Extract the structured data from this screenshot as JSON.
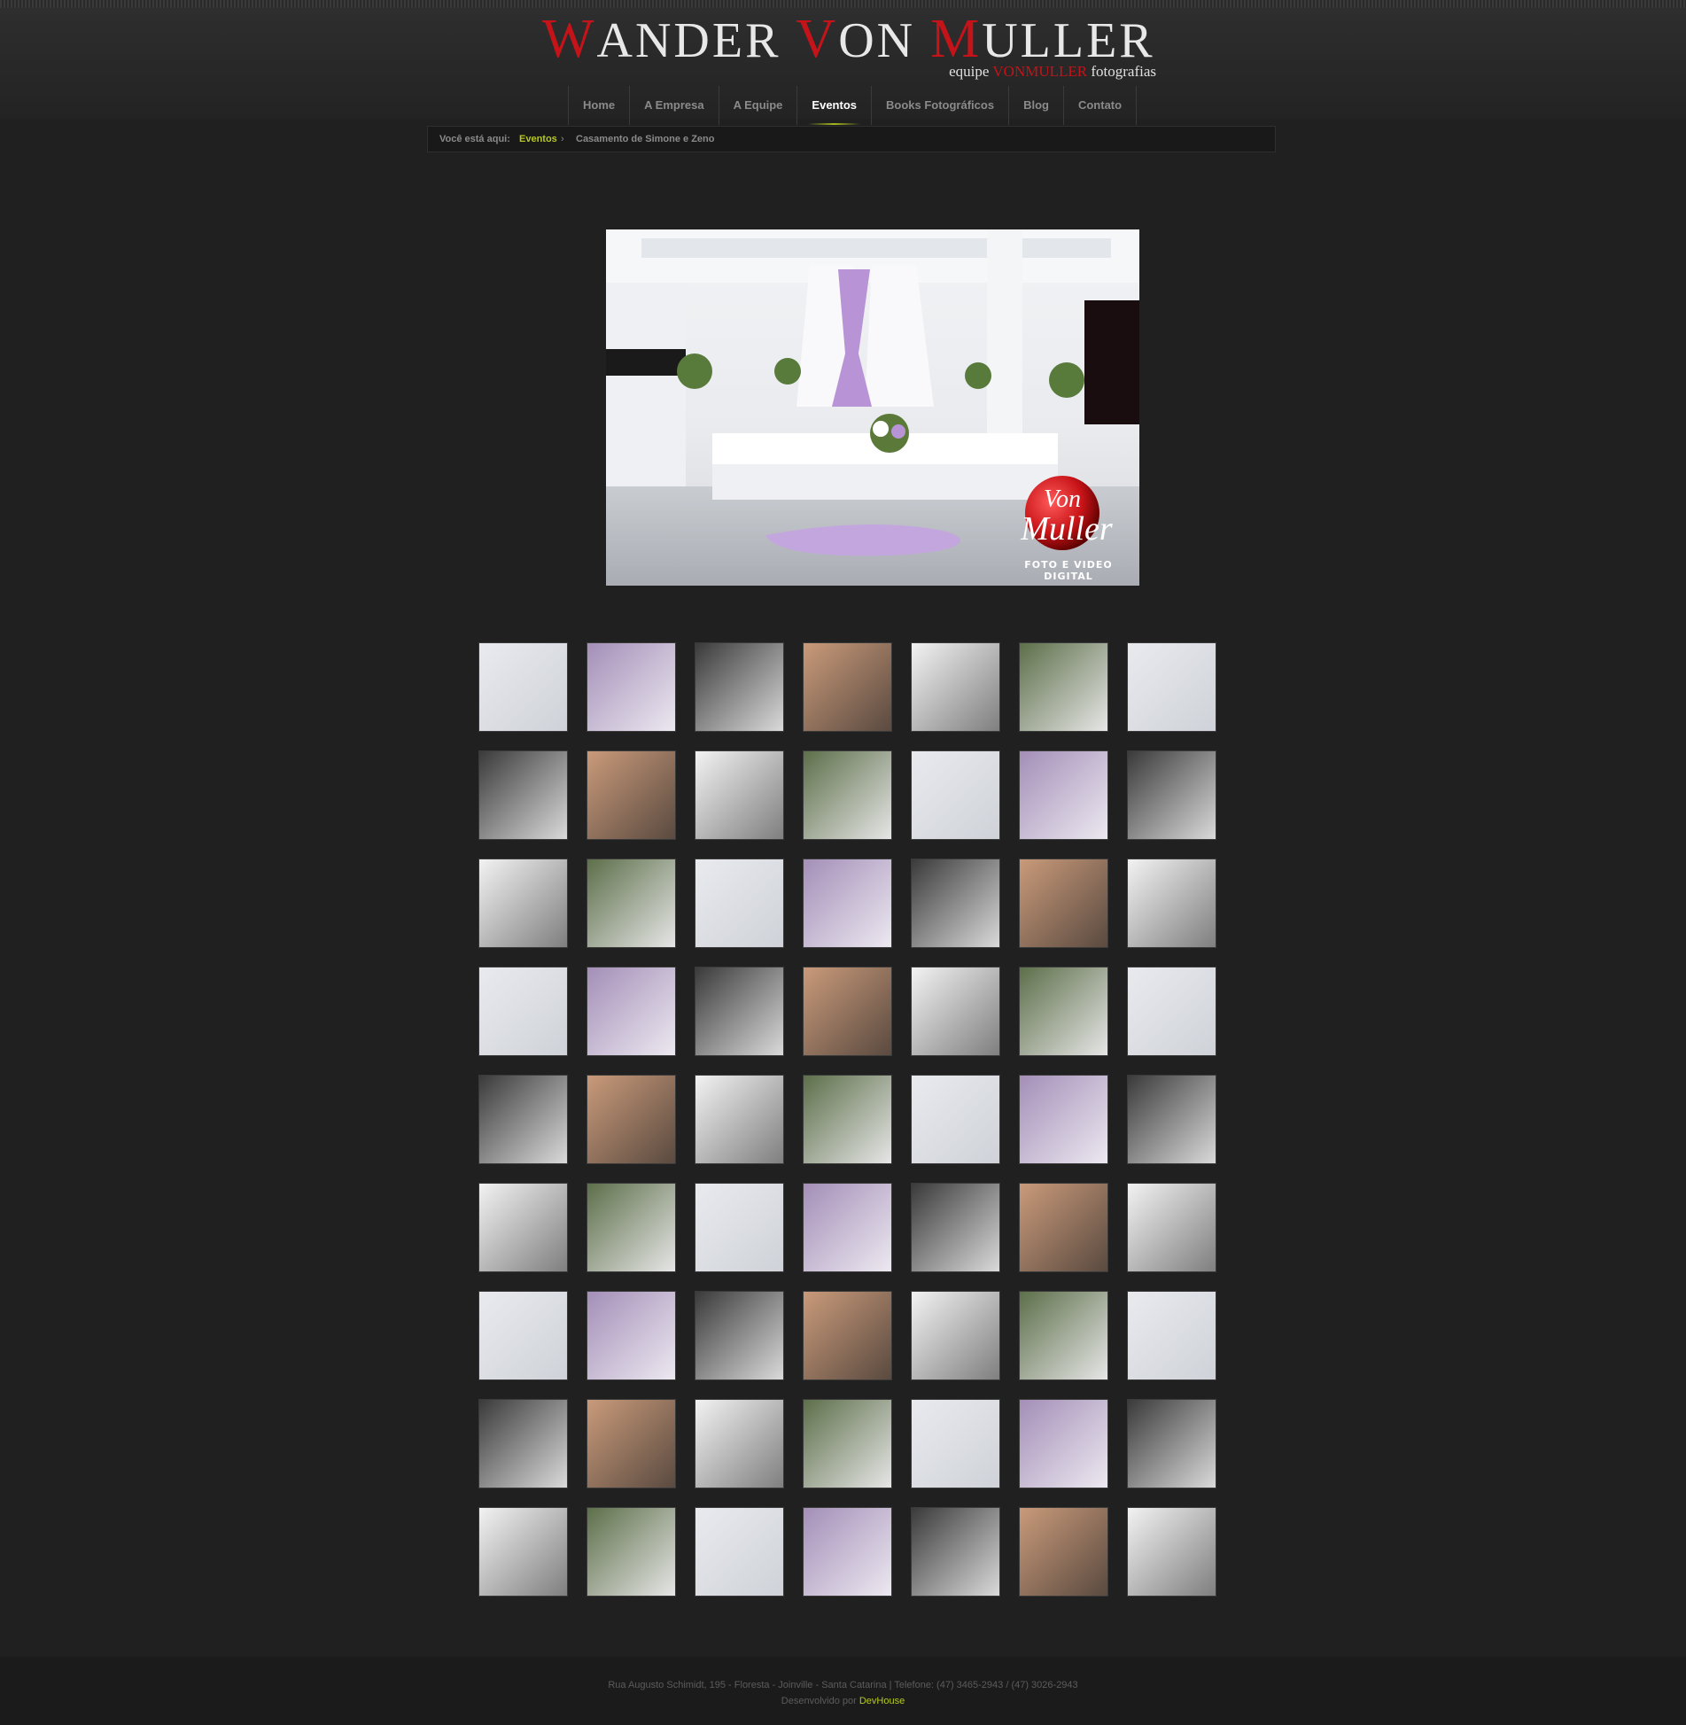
{
  "header": {
    "logo": {
      "w": "W",
      "ander": "ANDER ",
      "v": "V",
      "on": "ON ",
      "m": "M",
      "uller": "ULLER"
    },
    "tagline": {
      "prefix": "equipe ",
      "brand": "VONMULLER",
      "suffix": " fotografias"
    }
  },
  "nav": {
    "items": [
      {
        "label": "Home"
      },
      {
        "label": "A Empresa"
      },
      {
        "label": "A Equipe"
      },
      {
        "label": "Eventos"
      },
      {
        "label": "Books Fotográficos"
      },
      {
        "label": "Blog"
      },
      {
        "label": "Contato"
      }
    ],
    "active": "Eventos"
  },
  "breadcrumb": {
    "label": "Você está aqui:",
    "link": "Eventos",
    "separator": "›",
    "current": "Casamento de Simone e Zeno"
  },
  "main_photo": {
    "watermark_line1": "Von",
    "watermark_line2": "Muller",
    "watermark_caption": "FOTO E VIDEO DIGITAL"
  },
  "gallery": {
    "thumbnail_count": 63
  },
  "footer": {
    "address": "Rua Augusto Schimidt, 195 - Floresta - Joinville - Santa Catarina | Telefone: (47) 3465-2943 / (47) 3026-2943",
    "dev_prefix": "Desenvolvido por ",
    "dev_link": "DevHouse"
  },
  "colors": {
    "background": "#202020",
    "accent_red": "#c4141a",
    "accent_green": "#b6c820"
  }
}
